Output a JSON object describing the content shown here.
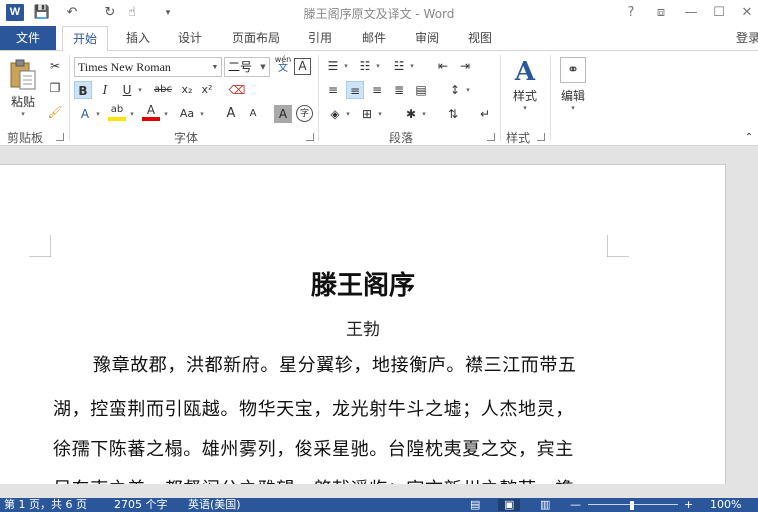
{
  "window": {
    "title": "滕王阁序原文及译文 - Word",
    "logo": "W",
    "help": "?",
    "restore_ribbon": "⧈",
    "minimize": "—",
    "maximize": "☐",
    "close": "✕"
  },
  "qat": {
    "save": "💾",
    "undo": "↶",
    "redo": "↻",
    "touch": "☝",
    "customize": "▾"
  },
  "tabs": {
    "file": "文件",
    "items": [
      "开始",
      "插入",
      "设计",
      "页面布局",
      "引用",
      "邮件",
      "审阅",
      "视图"
    ],
    "login": "登录"
  },
  "ribbon": {
    "clipboard": {
      "paste": "粘贴",
      "label": "剪贴板"
    },
    "font": {
      "font_name": "Times New Roman",
      "font_size": "二号",
      "bold": "B",
      "italic": "I",
      "underline": "U",
      "strike": "abc",
      "subscript": "x₂",
      "superscript": "x²",
      "phonetic": "wén",
      "phonetic_sub": "文",
      "border_char": "A",
      "grow": "A",
      "shrink": "A",
      "case": "Aa",
      "shade_char": "A",
      "enclose": "字",
      "highlight": "ab",
      "font_color": "A",
      "label": "字体"
    },
    "paragraph": {
      "label": "段落"
    },
    "styles": {
      "button": "样式",
      "label": "样式"
    },
    "editing": {
      "button": "编辑"
    }
  },
  "document": {
    "title": "滕王阁序",
    "author": "王勃",
    "lines": [
      "豫章故郡，洪都新府。星分翼轸，地接衡庐。襟三江而带五",
      "湖，控蛮荆而引瓯越。物华天宝，龙光射牛斗之墟；人杰地灵，",
      "徐孺下陈蕃之榻。雄州雾列，俊采星驰。台隍枕夷夏之交，宾主",
      "尽东南之美。都督阎公之雅望，棨戟遥临；宇文新州之懿范，襜"
    ]
  },
  "status": {
    "page": "第 1 页，共 6 页",
    "words": "2705 个字",
    "language": "英语(美国)",
    "zoom": "100%"
  }
}
